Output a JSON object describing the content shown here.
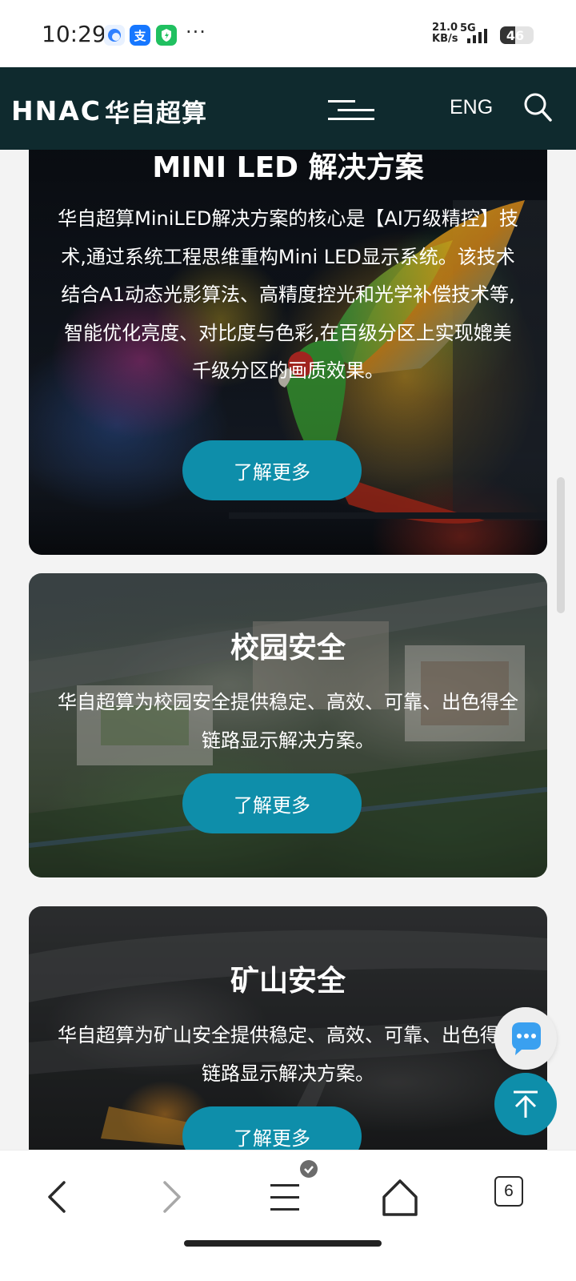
{
  "status_bar": {
    "time": "10:29",
    "app_icons": [
      {
        "name": "browser-icon",
        "label": "",
        "color": "#e6f0ff"
      },
      {
        "name": "alipay-icon",
        "label": "支",
        "color": "#1677ff"
      },
      {
        "name": "security-app-icon",
        "label": "",
        "color": "#20c060"
      }
    ],
    "more": "···",
    "net_speed_value": "21.0",
    "net_speed_unit": "KB/s",
    "network_type": "5G",
    "battery": "46",
    "battery_level": 0.46
  },
  "header": {
    "logo_latin": "HNAC",
    "logo_cn": "华自超算",
    "lang_label": "ENG",
    "background": "#0f2a2e"
  },
  "cards": [
    {
      "title": "MINI LED 解决方案",
      "text": "华自超算MiniLED解决方案的核心是【AI万级精控】技术,通过系统工程思维重构Mini LED显示系统。该技术结合A1动态光影算法、高精度控光和光学补偿技术等,智能优化亮度、对比度与色彩,在百级分区上实现媲美千级分区的画质效果。",
      "cta": "了解更多"
    },
    {
      "title": "校园安全",
      "text": "华自超算为校园安全提供稳定、高效、可靠、出色得全链路显示解决方案。",
      "cta": "了解更多"
    },
    {
      "title": "矿山安全",
      "text": "华自超算为矿山安全提供稳定、高效、可靠、出色得全链路显示解决方案。",
      "cta": "了解更多"
    }
  ],
  "accent_color": "#0e8eaa",
  "browser_bar": {
    "tabs_count": "6"
  }
}
